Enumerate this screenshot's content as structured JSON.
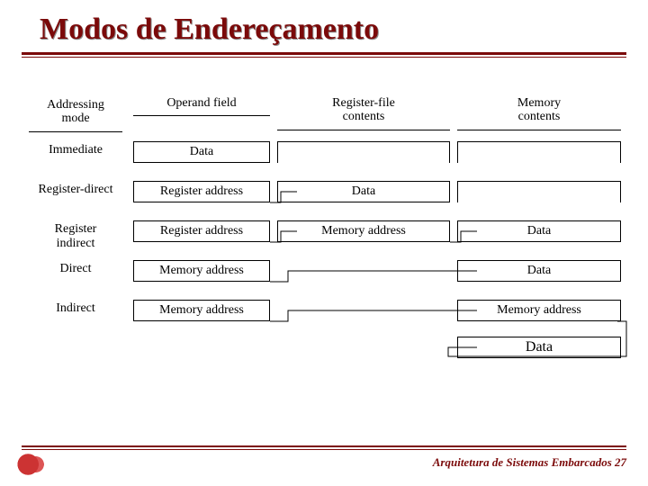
{
  "title": "Modos de Endereçamento",
  "headers": {
    "mode": "Addressing\nmode",
    "operand": "Operand field",
    "regfile": "Register-file\ncontents",
    "mem": "Memory\ncontents"
  },
  "rows": [
    {
      "mode": "Immediate",
      "operand": "Data",
      "regfile": "",
      "mem": ""
    },
    {
      "mode": "Register-direct",
      "operand": "Register address",
      "regfile": "Data",
      "mem": ""
    },
    {
      "mode": "Register\nindirect",
      "operand": "Register address",
      "regfile": "Memory address",
      "mem": "Data"
    },
    {
      "mode": "Direct",
      "operand": "Memory address",
      "regfile": "",
      "mem": "Data"
    },
    {
      "mode": "Indirect",
      "operand": "Memory address",
      "regfile": "",
      "mem": "Memory address"
    }
  ],
  "final_mem": "Data",
  "footer": "Arquitetura de Sistemas Embarcados 27"
}
